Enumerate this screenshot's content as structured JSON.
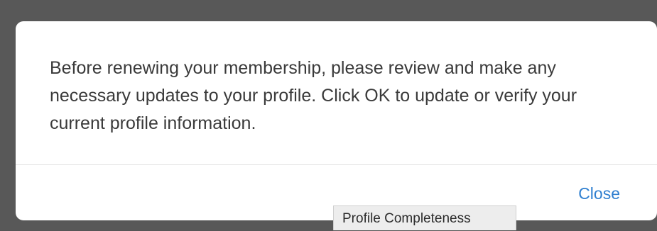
{
  "dialog": {
    "message": "Before renewing your membership, please review and make any necessary updates to your profile. Click OK to update or verify your current profile information.",
    "close_label": "Close"
  },
  "tooltip": {
    "text": "Profile Completeness"
  },
  "colors": {
    "backdrop": "#585858",
    "dialog_bg": "#ffffff",
    "link_blue": "#2f7fd0",
    "message_text": "#3a3a3a"
  }
}
